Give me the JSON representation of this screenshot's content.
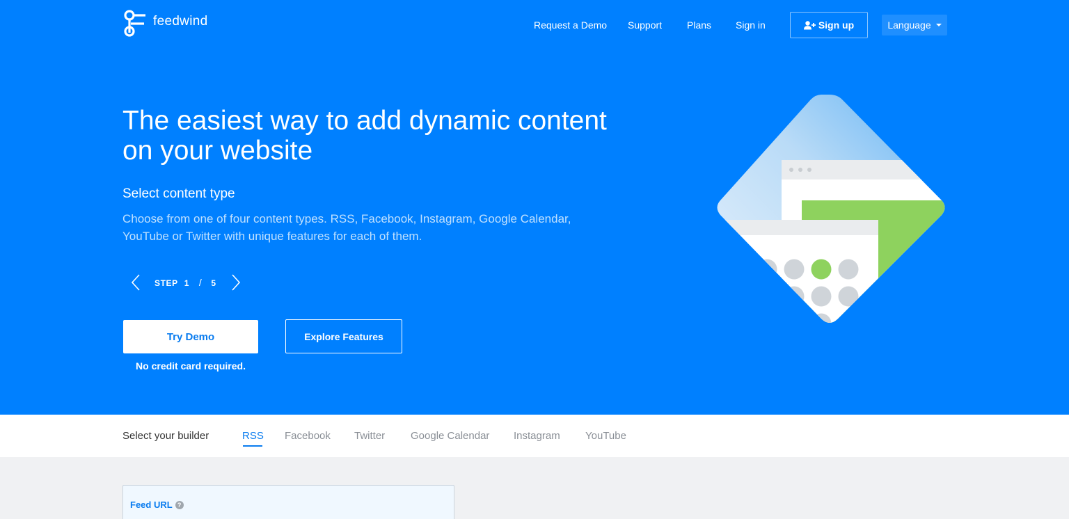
{
  "brand": {
    "name": "feedwind"
  },
  "nav": {
    "items": [
      {
        "label": "Request a Demo"
      },
      {
        "label": "Support"
      },
      {
        "label": "Plans"
      },
      {
        "label": "Sign in"
      }
    ],
    "signup_label": "Sign up",
    "language_label": "Language"
  },
  "hero": {
    "headline": "The easiest way to add dynamic content on your website",
    "subhead": "Select content type",
    "description": "Choose from one of four content types. RSS, Facebook, Instagram, Google Calendar, YouTube or Twitter with unique features for each of them.",
    "step": {
      "label": "STEP",
      "current": "1",
      "separator": "/",
      "total": "5"
    },
    "try_demo": "Try Demo",
    "explore": "Explore Features",
    "note": "No credit card required."
  },
  "builder": {
    "label": "Select your builder",
    "tabs": [
      {
        "label": "RSS",
        "active": true
      },
      {
        "label": "Facebook"
      },
      {
        "label": "Twitter"
      },
      {
        "label": "Google Calendar"
      },
      {
        "label": "Instagram"
      },
      {
        "label": "YouTube"
      }
    ]
  },
  "feed_panel": {
    "label": "Feed URL",
    "help": "?"
  },
  "colors": {
    "hero_bg": "#0080ff",
    "accent": "#0a7cef",
    "green": "#8ed25e",
    "dot_gray": "#cfd4d9"
  },
  "icons": {
    "signup": "user-plus-icon",
    "language": "caret-down-icon",
    "prev": "chevron-left-icon",
    "next": "chevron-right-icon",
    "help": "question-circle-icon"
  }
}
